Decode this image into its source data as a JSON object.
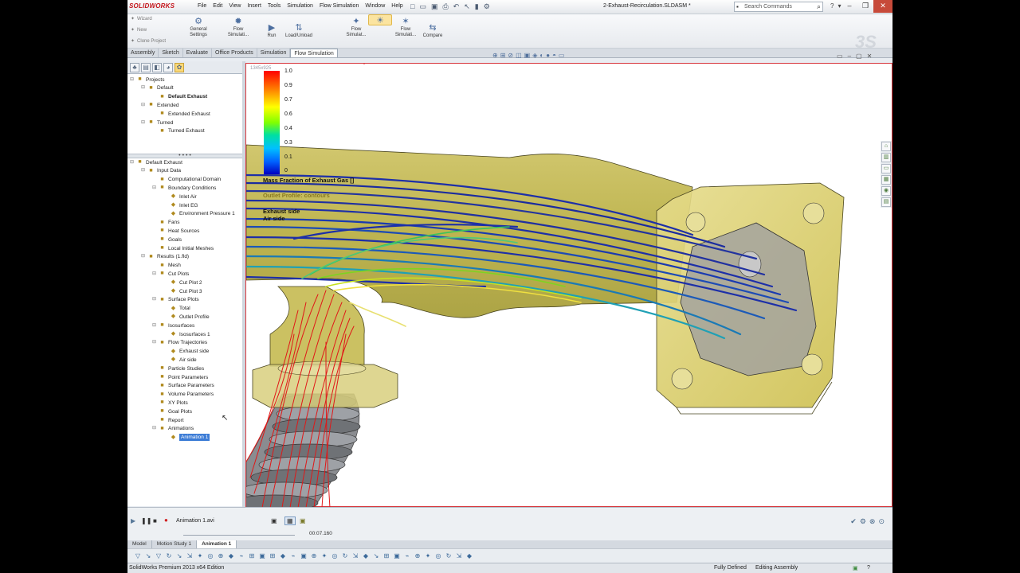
{
  "app": {
    "logo": "SOLIDWORKS",
    "document_title": "2-Exhaust-Recirculation.SLDASM *"
  },
  "menus": [
    "File",
    "Edit",
    "View",
    "Insert",
    "Tools",
    "Simulation",
    "Flow Simulation",
    "Window",
    "Help"
  ],
  "search": {
    "placeholder": "Search Commands"
  },
  "ribbon": {
    "small_commands": [
      "Wizard",
      "New",
      "Clone Project"
    ],
    "buttons": [
      "General Settings",
      "Flow Simulati...",
      "Run",
      "Load/Unload",
      "Flow Simulat...",
      "Flow Simulati...",
      "Compare"
    ]
  },
  "command_tabs": [
    "Assembly",
    "Sketch",
    "Evaluate",
    "Office Products",
    "Simulation",
    "Flow Simulation"
  ],
  "projects_tree": {
    "root": "Projects",
    "items": [
      {
        "label": "Default",
        "level": 1
      },
      {
        "label": "Default Exhaust",
        "level": 2,
        "bold": true
      },
      {
        "label": "Extended",
        "level": 1
      },
      {
        "label": "Extended Exhaust",
        "level": 2
      },
      {
        "label": "Turned",
        "level": 1
      },
      {
        "label": "Turned Exhaust",
        "level": 2
      }
    ]
  },
  "analysis_tree": {
    "root": "Default Exhaust",
    "items": [
      {
        "label": "Input Data",
        "level": 1
      },
      {
        "label": "Computational Domain",
        "level": 2
      },
      {
        "label": "Boundary Conditions",
        "level": 2
      },
      {
        "label": "Inlet Air",
        "level": 3
      },
      {
        "label": "Inlet EG",
        "level": 3
      },
      {
        "label": "Environment Pressure 1",
        "level": 3
      },
      {
        "label": "Fans",
        "level": 2
      },
      {
        "label": "Heat Sources",
        "level": 2
      },
      {
        "label": "Goals",
        "level": 2
      },
      {
        "label": "Local Initial Meshes",
        "level": 2
      },
      {
        "label": "Results (1.fld)",
        "level": 1
      },
      {
        "label": "Mesh",
        "level": 2
      },
      {
        "label": "Cut Plots",
        "level": 2
      },
      {
        "label": "Cut Plot 2",
        "level": 3
      },
      {
        "label": "Cut Plot 3",
        "level": 3
      },
      {
        "label": "Surface Plots",
        "level": 2
      },
      {
        "label": "Total",
        "level": 3
      },
      {
        "label": "Outlet Profile",
        "level": 3
      },
      {
        "label": "Isosurfaces",
        "level": 2
      },
      {
        "label": "Isosurfaces 1",
        "level": 3
      },
      {
        "label": "Flow Trajectories",
        "level": 2
      },
      {
        "label": "Exhaust side",
        "level": 3
      },
      {
        "label": "Air side",
        "level": 3
      },
      {
        "label": "Particle Studies",
        "level": 2
      },
      {
        "label": "Point Parameters",
        "level": 2
      },
      {
        "label": "Surface Parameters",
        "level": 2
      },
      {
        "label": "Volume Parameters",
        "level": 2
      },
      {
        "label": "XY Plots",
        "level": 2
      },
      {
        "label": "Goal Plots",
        "level": 2
      },
      {
        "label": "Report",
        "level": 2
      },
      {
        "label": "Animations",
        "level": 2
      },
      {
        "label": "Animation 1",
        "level": 3,
        "selected": true
      }
    ]
  },
  "graphics": {
    "dim_label": "1345x925",
    "legend_ticks": [
      "1.0",
      "0.9",
      "0.7",
      "0.6",
      "0.4",
      "0.3",
      "0.1",
      "0"
    ],
    "legend_title": "Mass Fraction of Exhaust Gas []",
    "annotations": [
      "Outlet Profile: contours",
      "Exhaust side",
      "Air side"
    ]
  },
  "animation": {
    "file": "Animation 1.avi",
    "time": "00:07.160"
  },
  "motion_tabs": [
    "Model",
    "Motion Study 1",
    "Animation 1"
  ],
  "status": {
    "edition": "SolidWorks Premium 2013 x64 Edition",
    "fully_defined": "Fully Defined",
    "mode": "Editing Assembly"
  }
}
